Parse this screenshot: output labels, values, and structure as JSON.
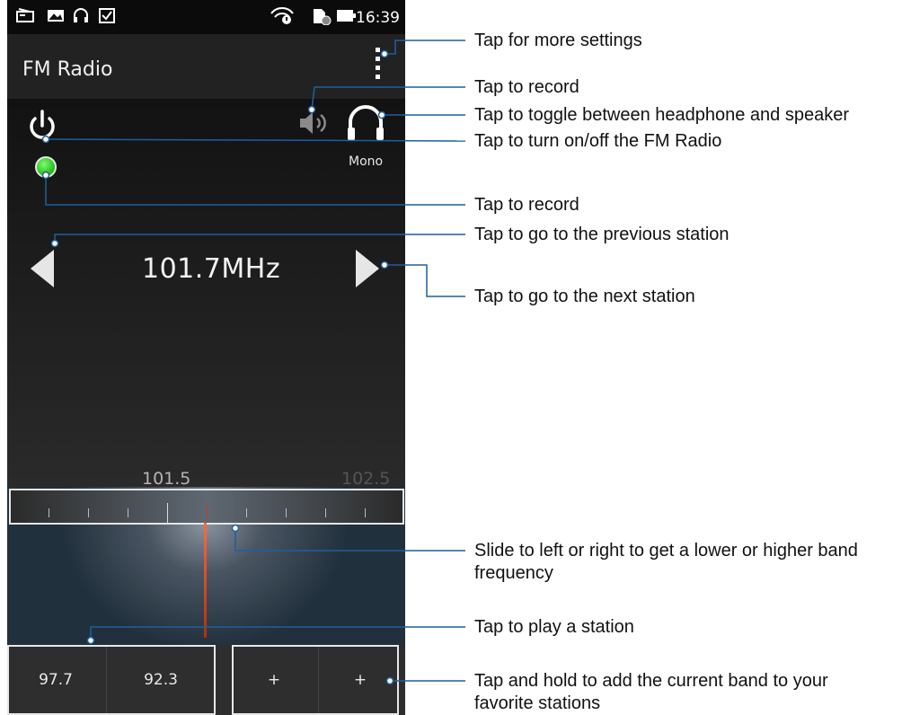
{
  "status_bar": {
    "icons": [
      "radio-icon",
      "image-icon",
      "headphone-icon",
      "checkbox-icon",
      "wifi-icon",
      "sim-icon",
      "battery-icon"
    ],
    "time": "16:39"
  },
  "app_bar": {
    "title": "FM Radio",
    "menu_icon": "overflow-menu-icon"
  },
  "controls": {
    "power_icon": "power-icon",
    "record_indicator_color": "#2ecc2e",
    "speaker_icon": "speaker-icon",
    "headphone_icon": "headphone-icon",
    "audio_mode": "Mono"
  },
  "tuner": {
    "frequency": "101.7MHz",
    "prev_icon": "triangle-left-icon",
    "next_icon": "triangle-right-icon",
    "scale_labels": [
      "101.5",
      "102.5"
    ],
    "needle_color": "#d0371f"
  },
  "stations": [
    {
      "label": "97.7"
    },
    {
      "label": "92.3"
    },
    {
      "label": "+"
    },
    {
      "label": "+"
    }
  ],
  "callouts": {
    "more_settings": "Tap for more settings",
    "record_top": "Tap to record",
    "toggle_audio": "Tap to toggle between headphone and speaker",
    "power": "Tap to turn on/off the FM Radio",
    "record": "Tap to record",
    "previous": "Tap to go to the previous station",
    "next": "Tap to go to the next station",
    "slide": "Slide to left or right to get a lower or higher band frequency",
    "play": "Tap to play a station",
    "hold_add": "Tap and hold to add the current band to your favorite stations"
  }
}
